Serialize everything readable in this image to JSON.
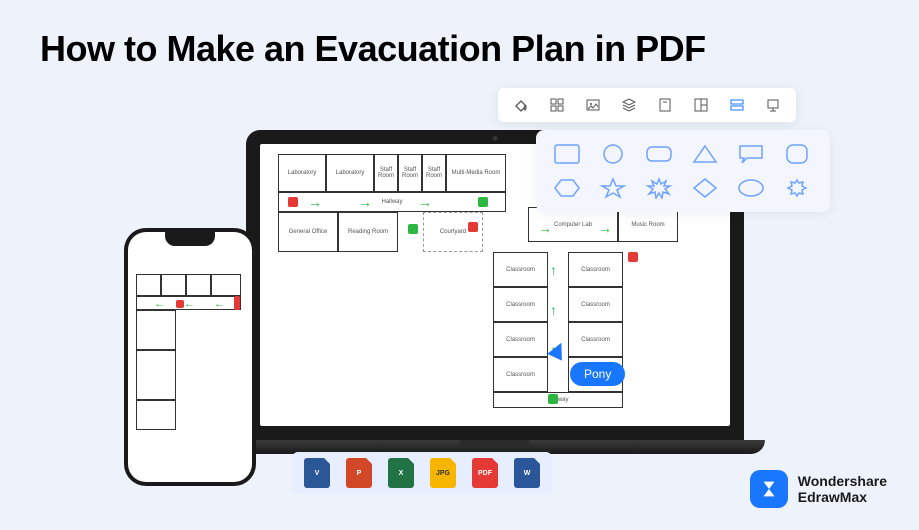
{
  "title": "How to Make an  Evacuation Plan in PDF",
  "cursor_label": "Pony",
  "brand": {
    "line1": "Wondershare",
    "line2": "EdrawMax"
  },
  "toolbar_icons": [
    "fill-bucket-icon",
    "grid-icon",
    "image-icon",
    "layers-icon",
    "page-icon",
    "layout-icon",
    "storage-icon",
    "presentation-icon"
  ],
  "shapes": [
    "rectangle",
    "circle",
    "rounded-rect",
    "triangle",
    "callout",
    "rounded-square",
    "hexagon",
    "star",
    "burst",
    "diamond",
    "ellipse",
    "gear"
  ],
  "formats": [
    {
      "name": "visio",
      "label": "V",
      "class": "fmt-v"
    },
    {
      "name": "powerpoint",
      "label": "P",
      "class": "fmt-p"
    },
    {
      "name": "excel",
      "label": "X",
      "class": "fmt-x"
    },
    {
      "name": "jpg",
      "label": "JPG",
      "class": "fmt-jpg"
    },
    {
      "name": "pdf",
      "label": "PDF",
      "class": "fmt-pdf"
    },
    {
      "name": "word",
      "label": "W",
      "class": "fmt-w"
    }
  ],
  "rooms": {
    "laboratory1": "Laboratory",
    "laboratory2": "Laboratory",
    "staff1": "Staff Room",
    "staff2": "Staff Room",
    "staff3": "Staff Room",
    "multimedia": "Multi-Media Room",
    "hallway1": "Hallway",
    "general_office": "General Office",
    "reading": "Reading Room",
    "courtyard": "Courtyard",
    "computer": "Computer Lab",
    "music": "Music Room",
    "classroom": "Classroom",
    "hallway2": "Hallway"
  }
}
